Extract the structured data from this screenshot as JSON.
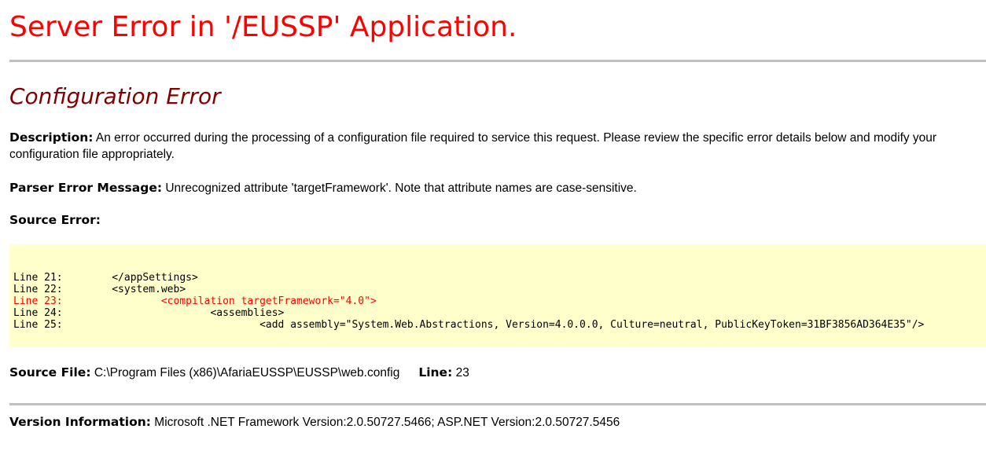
{
  "title": "Server Error in '/EUSSP' Application.",
  "subtitle": "Configuration Error",
  "description": {
    "label": "Description:",
    "text": " An error occurred during the processing of a configuration file required to service this request. Please review the specific error details below and modify your configuration file appropriately."
  },
  "parser": {
    "label": "Parser Error Message:",
    "text": " Unrecognized attribute 'targetFramework'. Note that attribute names are case-sensitive."
  },
  "source_error": {
    "label": "Source Error:"
  },
  "code": {
    "lines": [
      {
        "text": "Line 21:        </appSettings>"
      },
      {
        "text": "Line 22:        <system.web>"
      },
      {
        "text": "Line 23:                <compilation targetFramework=\"4.0\">"
      },
      {
        "text": "Line 24:                        <assemblies>"
      },
      {
        "text": "Line 25:                                <add assembly=\"System.Web.Abstractions, Version=4.0.0.0, Culture=neutral, PublicKeyToken=31BF3856AD364E35\"/>"
      }
    ],
    "error_line": "Line 23",
    "error_color": "#ff0000",
    "background": "#ffffcc"
  },
  "source_file": {
    "label": "Source File:",
    "path": " C:\\Program Files (x86)\\AfariaEUSSP\\EUSSP\\web.config",
    "line_label": "Line:",
    "line_value": " 23"
  },
  "version": {
    "label": "Version Information:",
    "text": " Microsoft .NET Framework Version:2.0.50727.5466; ASP.NET Version:2.0.50727.5456"
  },
  "colors": {
    "title": "#ff0000",
    "subtitle": "#800000",
    "rule": "#c0c0c0"
  }
}
